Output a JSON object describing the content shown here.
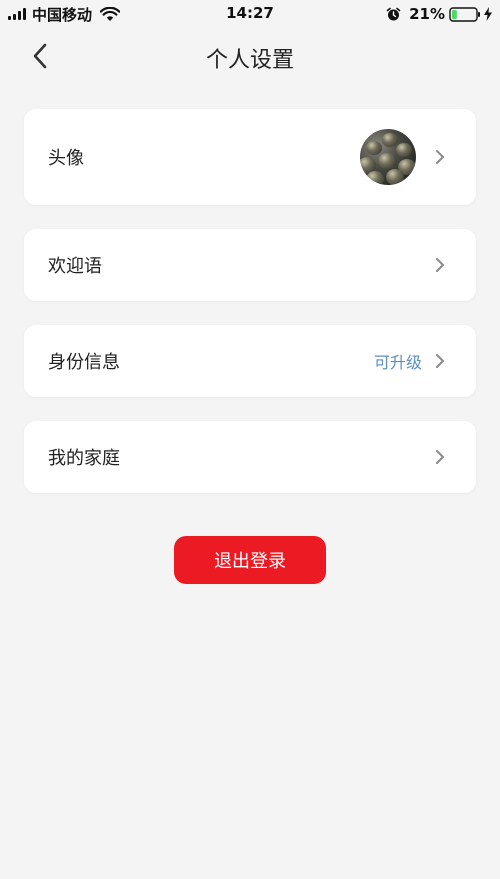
{
  "status_bar": {
    "carrier": "中国移动",
    "time": "14:27",
    "battery_percent": "21%",
    "battery_level": 0.21,
    "icons": [
      "signal-icon",
      "wifi-icon",
      "alarm-icon",
      "battery-icon",
      "charging-icon"
    ]
  },
  "header": {
    "title": "个人设置",
    "back_icon": "chevron-left-icon"
  },
  "settings": {
    "items": [
      {
        "label": "头像",
        "accessory": "avatar",
        "icon": "chevron-right-icon"
      },
      {
        "label": "欢迎语",
        "icon": "chevron-right-icon"
      },
      {
        "label": "身份信息",
        "value": "可升级",
        "icon": "chevron-right-icon"
      },
      {
        "label": "我的家庭",
        "icon": "chevron-right-icon"
      }
    ]
  },
  "actions": {
    "logout_label": "退出登录"
  },
  "colors": {
    "background": "#f4f4f4",
    "card": "#ffffff",
    "accent_red": "#ec1b23",
    "link_blue": "#5b8fc0",
    "battery_green": "#4cd964"
  }
}
